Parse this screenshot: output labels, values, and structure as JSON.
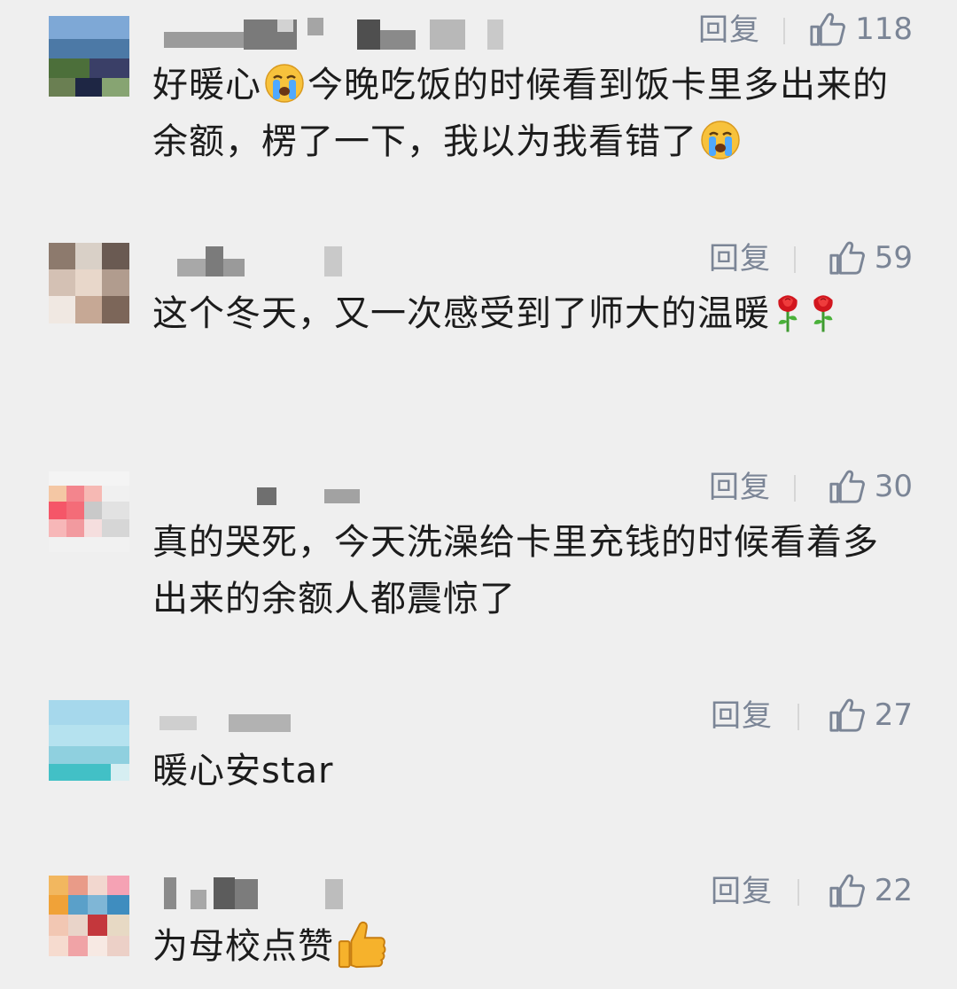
{
  "comments": [
    {
      "reply_label": "回复",
      "likes": "118",
      "text_a": "好暖心",
      "text_b": "今晚吃饭的时候看到饭卡里多出来的余额，楞了一下，我以为我看错了",
      "emoji_a": "crying-face",
      "emoji_b": "crying-face"
    },
    {
      "reply_label": "回复",
      "likes": "59",
      "text": "这个冬天，又一次感受到了师大的温暖",
      "emoji": "rose"
    },
    {
      "reply_label": "回复",
      "likes": "30",
      "text": "真的哭死，今天洗澡给卡里充钱的时候看着多出来的余额人都震惊了"
    },
    {
      "reply_label": "回复",
      "likes": "27",
      "text": "暖心安star"
    },
    {
      "reply_label": "回复",
      "likes": "22",
      "text": "为母校点赞",
      "emoji": "thumbs-up"
    }
  ]
}
